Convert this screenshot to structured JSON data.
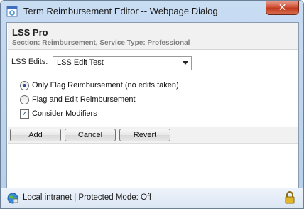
{
  "window": {
    "title": "Term Reimbursement Editor -- Webpage Dialog",
    "close_label": "✕"
  },
  "header": {
    "title": "LSS Pro",
    "subtitle": "Section: Reimbursement, Service Type: Professional"
  },
  "lss_edits": {
    "label": "LSS Edits:",
    "selected": "LSS Edit Test"
  },
  "options": {
    "only_flag": {
      "label": "Only Flag Reimbursement (no edits taken)",
      "selected": true
    },
    "flag_edit": {
      "label": "Flag and Edit Reimbursement",
      "selected": false
    },
    "consider_modifiers": {
      "label": "Consider Modifiers",
      "checked": true,
      "mark": "✓"
    }
  },
  "buttons": {
    "add": "Add",
    "cancel": "Cancel",
    "revert": "Revert"
  },
  "statusbar": {
    "text": "Local intranet | Protected Mode: Off"
  },
  "colors": {
    "accent": "#2a4f97",
    "close": "#c23a1d"
  }
}
